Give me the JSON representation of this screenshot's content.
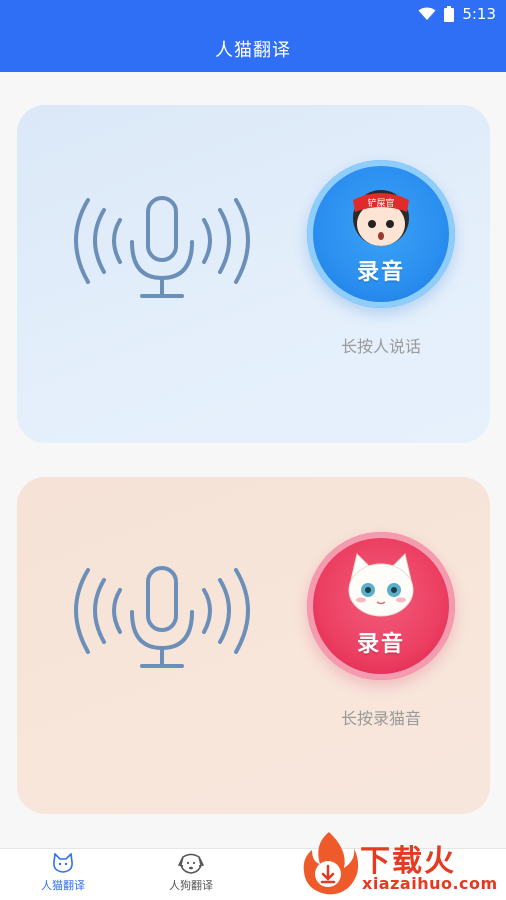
{
  "status_bar": {
    "time": "5:13",
    "wifi_icon": "wifi-icon",
    "battery_icon": "battery-icon"
  },
  "app_bar": {
    "title": "人猫翻译"
  },
  "human_card": {
    "record_label": "录音",
    "badge_text": "铲屎官",
    "hint": "长按人说话"
  },
  "cat_card": {
    "record_label": "录音",
    "hint": "长按录猫音"
  },
  "bottom_nav": {
    "items": [
      {
        "label": "人猫翻译",
        "icon": "cat-icon",
        "active": true
      },
      {
        "label": "人狗翻译",
        "icon": "dog-icon",
        "active": false
      }
    ]
  },
  "watermark": {
    "title": "下载火",
    "subtitle": "xiazaihuo.com"
  },
  "colors": {
    "accent": "#2f6ff5",
    "human_button": "#2b8ff0",
    "cat_button": "#ec3f62",
    "watermark": "#e53a1f"
  }
}
